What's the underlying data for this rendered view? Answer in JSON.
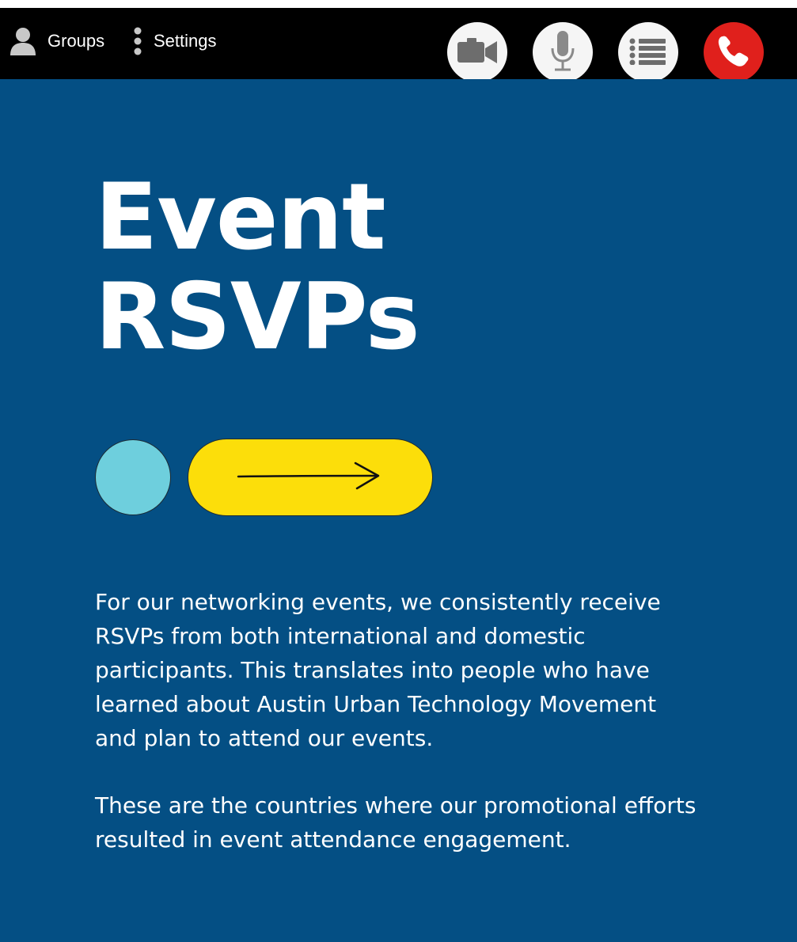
{
  "toolbar": {
    "groups_label": "Groups",
    "settings_label": "Settings",
    "icons": {
      "groups": "person-icon",
      "settings": "vertical-dots-icon",
      "video": "video-camera-icon",
      "mic": "microphone-icon",
      "list": "list-icon",
      "hangup": "phone-hangup-icon"
    },
    "colors": {
      "bar": "#000000",
      "button": "#f5f5f5",
      "hangup": "#e0201c"
    }
  },
  "slide": {
    "title": "Event\nRSVPs",
    "paragraph1": "For our networking events, we consistently receive RSVPs from both international and domestic participants. This translates into people who have learned about Austin Urban Technology Movement and plan to attend our events.",
    "paragraph2": "These are the countries where our promotional efforts resulted in event attendance engagement.",
    "colors": {
      "background": "#044f84",
      "dot": "#6ecfdd",
      "pill": "#fcde0a",
      "text": "#ffffff"
    }
  }
}
